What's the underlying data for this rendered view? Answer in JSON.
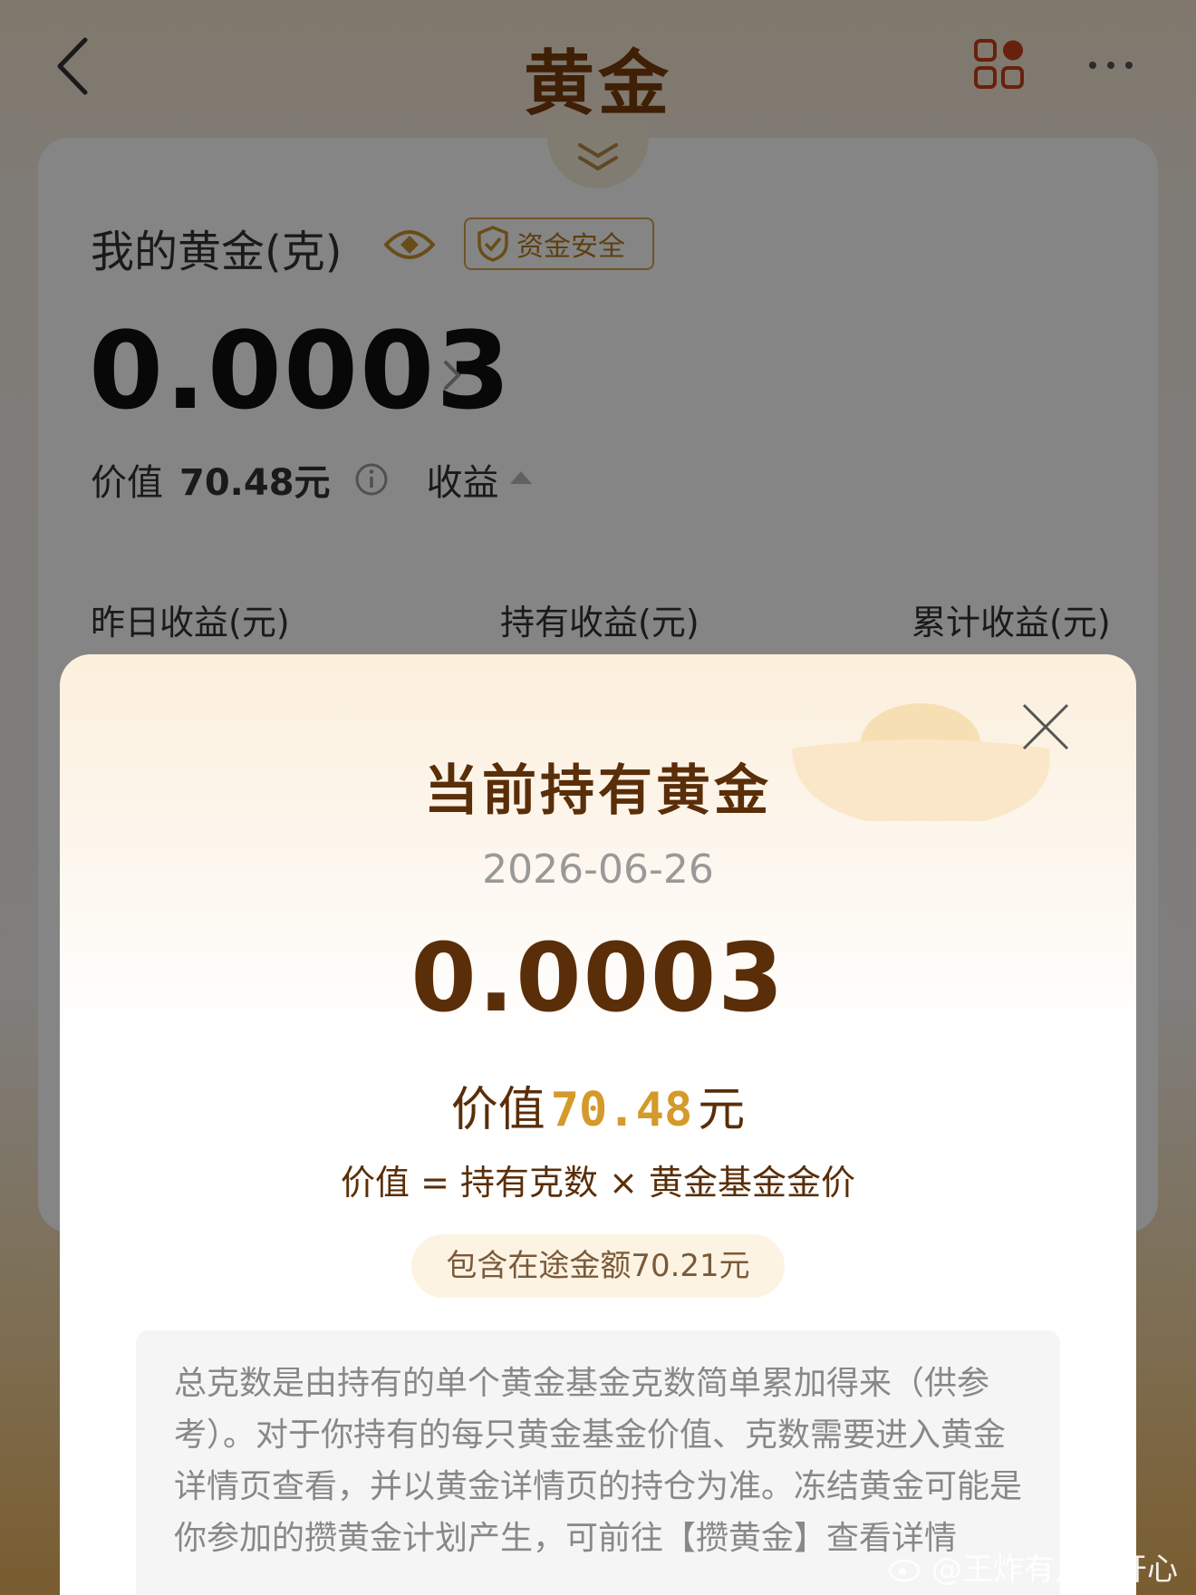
{
  "nav": {
    "title": "黄金",
    "back_icon": "chevron-left-icon",
    "apps_icon": "grid-apps-icon",
    "more_icon": "more-dots-icon"
  },
  "card": {
    "my_gold_label": "我的黄金(克)",
    "safe_badge": "资金安全",
    "gold_amount": "0.0003",
    "value_label": "价值",
    "value_amount": "70.48元",
    "income_label": "收益",
    "columns": [
      "昨日收益(元)",
      "持有收益(元)",
      "累计收益(元)"
    ]
  },
  "modal": {
    "title": "当前持有黄金",
    "date": "2026-06-26",
    "amount": "0.0003",
    "value_prefix": "价值",
    "value_number": "70.48",
    "value_suffix": "元",
    "formula": "价值 = 持有克数 × 黄金基金金价",
    "pill": "包含在途金额70.21元",
    "note": "总克数是由持有的单个黄金基金克数简单累加得来（供参考）。对于你持有的每只黄金基金价值、克数需要进入黄金详情页查看，并以黄金详情页的持仓为准。冻结黄金可能是你参加的攒黄金计划产生，可前往【攒黄金】查看详情"
  },
  "watermark": "@王炸有点小开心",
  "colors": {
    "brand_brown": "#5a2e08",
    "accent_gold": "#d49a2a",
    "nav_icon_red": "#c8401c"
  }
}
